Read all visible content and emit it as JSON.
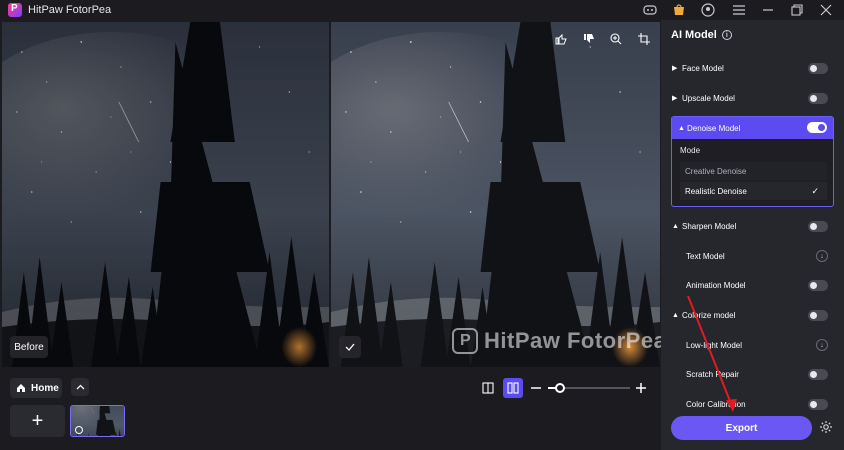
{
  "window": {
    "title": "HitPaw FotorPea",
    "controls": [
      "discord-icon",
      "shop-icon",
      "account-icon",
      "menu-icon",
      "minimize-icon",
      "restore-icon",
      "close-icon"
    ]
  },
  "preview": {
    "before_label": "Before",
    "after_tools": [
      "thumbs-up-icon",
      "thumbs-down-icon",
      "zoom-icon",
      "crop-icon"
    ],
    "watermark": "HitPaw FotorPea"
  },
  "bottom": {
    "home_label": "Home",
    "add_label": "+",
    "zoom_level_fraction": 0.15
  },
  "right_panel": {
    "title": "AI Model",
    "models": {
      "face": {
        "label": "Face Model",
        "enabled": false
      },
      "upscale": {
        "label": "Upscale Model",
        "enabled": false
      },
      "denoise": {
        "label": "Denoise Model",
        "enabled": true
      },
      "sharpen": {
        "label": "Sharpen Model",
        "enabled": false
      },
      "text": {
        "label": "Text Model"
      },
      "animation": {
        "label": "Animation Model",
        "enabled": false
      },
      "colorize": {
        "label": "Colorize model",
        "enabled": false
      },
      "lowlight": {
        "label": "Low-light Model"
      },
      "scratch": {
        "label": "Scratch Repair",
        "enabled": false
      },
      "calibration": {
        "label": "Color Calibration",
        "enabled": false
      }
    },
    "denoise_mode": {
      "label": "Mode",
      "options": [
        "Creative Denoise",
        "Realistic Denoise"
      ],
      "selected": "Realistic Denoise"
    },
    "export_label": "Export"
  },
  "colors": {
    "accent": "#5c4bf0",
    "export": "#6b57f4",
    "panel": "#26262d",
    "annotation": "#e01b24"
  }
}
